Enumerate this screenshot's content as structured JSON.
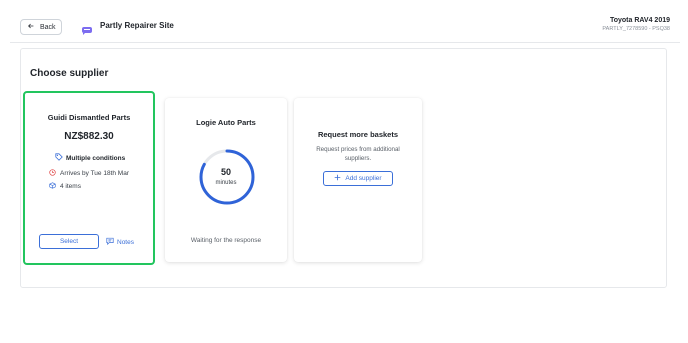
{
  "header": {
    "back_label": "Back",
    "site_title": "Partly Repairer Site",
    "vehicle_name": "Toyota RAV4 2019",
    "vehicle_code": "PARTLY_7278590 - PSQ38"
  },
  "main": {
    "section_title": "Choose supplier"
  },
  "suppliers": [
    {
      "name": "Guidi Dismantled Parts",
      "price": "NZ$882.30",
      "conditions": "Multiple conditions",
      "arrival": "Arrives by Tue 18th Mar",
      "items": "4 items",
      "select_label": "Select",
      "notes_label": "Notes",
      "selected": true
    },
    {
      "name": "Logie Auto Parts",
      "countdown_value": "50",
      "countdown_unit": "minutes",
      "countdown_progress": 0.83,
      "status": "Waiting for the response"
    }
  ],
  "more_baskets": {
    "title": "Request more baskets",
    "description": "Request prices from additional suppliers.",
    "button_label": "Add supplier"
  },
  "colors": {
    "accent": "#3b6fd8",
    "selected_border": "#22c55e",
    "site_icon": "#7c6cf0",
    "warning": "#e04646"
  },
  "icons": [
    "arrow-left-icon",
    "site-logo-icon",
    "tag-icon",
    "clock-icon",
    "box-icon",
    "note-icon",
    "plus-icon"
  ]
}
